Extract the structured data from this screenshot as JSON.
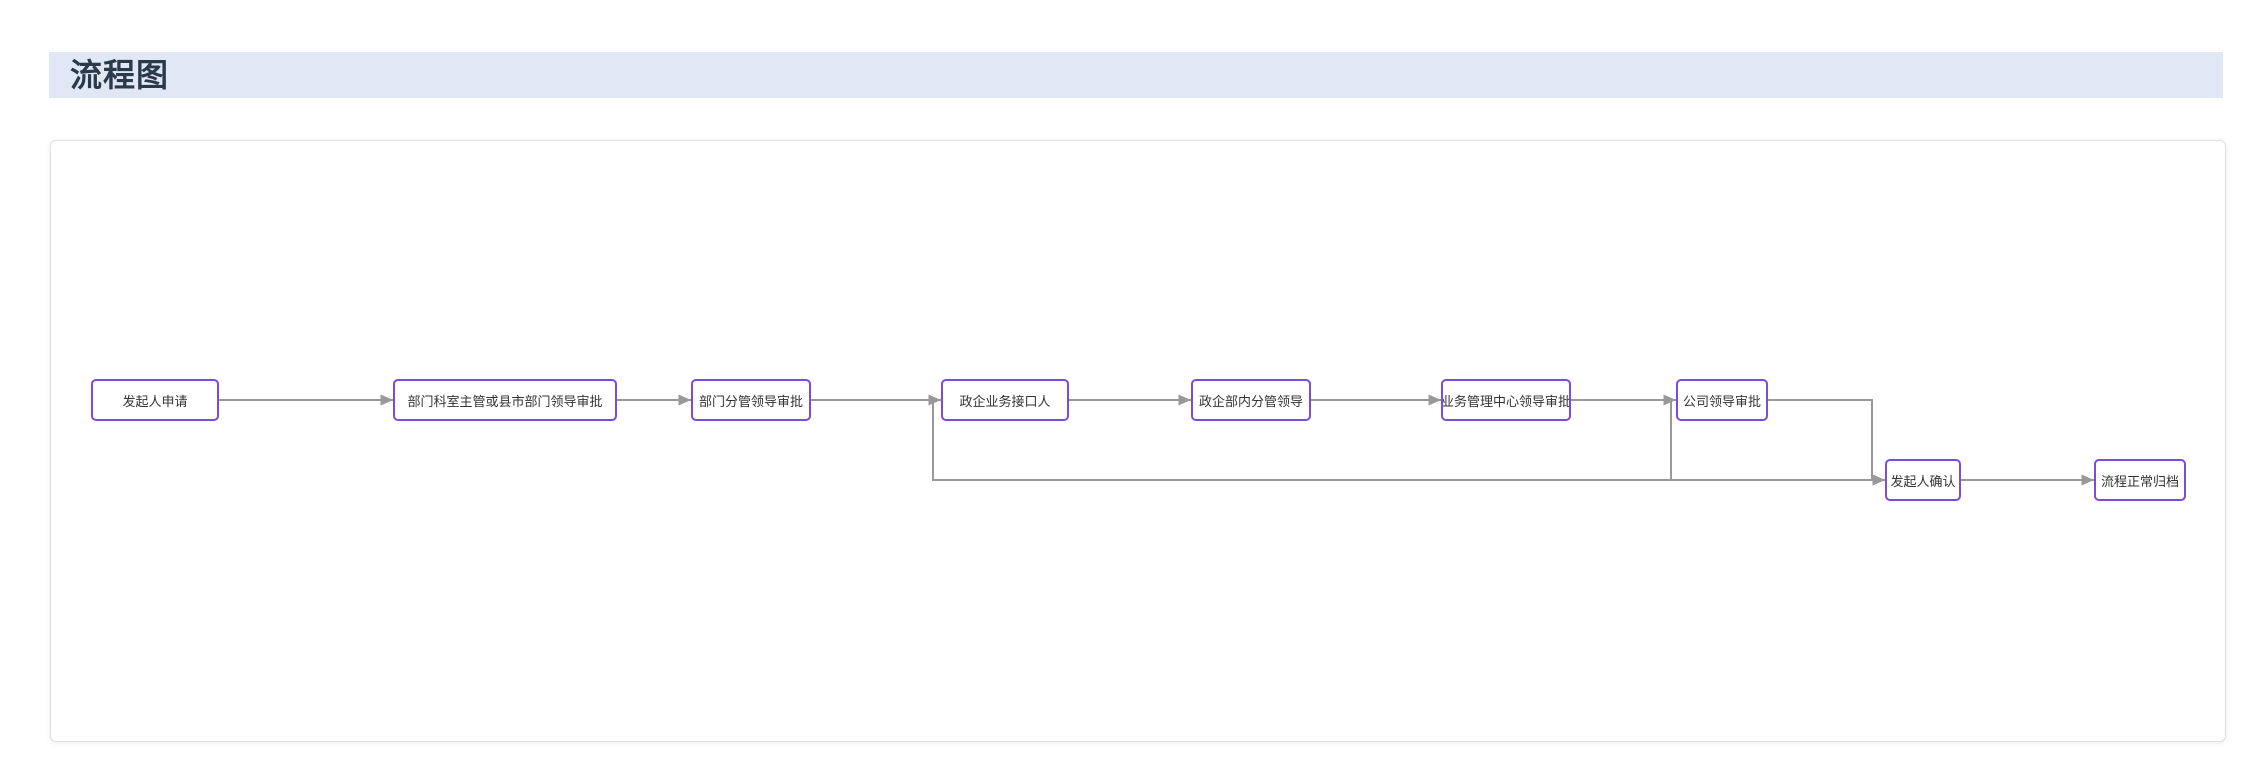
{
  "page": {
    "title": "流程图"
  },
  "flowchart": {
    "nodes": [
      {
        "id": "n1",
        "label": "发起人申请"
      },
      {
        "id": "n2",
        "label": "部门科室主管或县市部门领导审批"
      },
      {
        "id": "n3",
        "label": "部门分管领导审批"
      },
      {
        "id": "n4",
        "label": "政企业务接口人"
      },
      {
        "id": "n5",
        "label": "政企部内分管领导"
      },
      {
        "id": "n6",
        "label": "业务管理中心领导审批"
      },
      {
        "id": "n7",
        "label": "公司领导审批"
      },
      {
        "id": "n8",
        "label": "发起人确认"
      },
      {
        "id": "n9",
        "label": "流程正常归档"
      }
    ],
    "edges": [
      {
        "from": "n1",
        "to": "n2"
      },
      {
        "from": "n2",
        "to": "n3"
      },
      {
        "from": "n3",
        "to": "n4"
      },
      {
        "from": "n4",
        "to": "n5"
      },
      {
        "from": "n5",
        "to": "n6"
      },
      {
        "from": "n6",
        "to": "n7"
      },
      {
        "from": "n7",
        "to": "n8"
      },
      {
        "from": "n3",
        "to": "n8"
      },
      {
        "from": "n6",
        "to": "n8"
      },
      {
        "from": "n8",
        "to": "n9"
      }
    ],
    "colors": {
      "node_border": "#7b4cd8",
      "edge": "#999999",
      "title_bar": "#e1e8f5"
    }
  }
}
